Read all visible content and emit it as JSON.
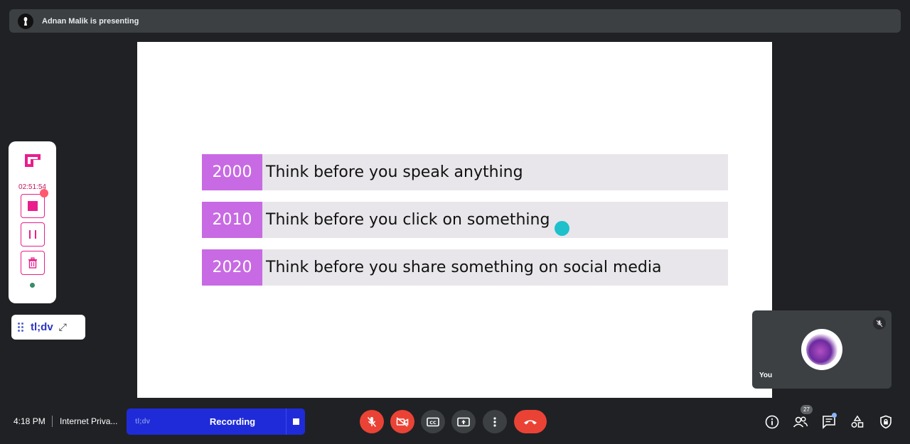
{
  "presenter_bar": {
    "text": "Adnan Malik is presenting"
  },
  "slide": {
    "rows": [
      {
        "year": "2000",
        "text": "Think before you speak anything"
      },
      {
        "year": "2010",
        "text": "Think before you click on something"
      },
      {
        "year": "2020",
        "text": "Think before you share something on social media"
      }
    ]
  },
  "recorder": {
    "timer": "02:51:54",
    "brand": "tl;dv"
  },
  "self_tile": {
    "name": "You"
  },
  "bottom": {
    "time": "4:18 PM",
    "meeting_name": "Internet Priva...",
    "recording_brand": "tl;dv",
    "recording_label": "Recording",
    "people_count": "27"
  },
  "colors": {
    "background": "#202124",
    "year_accent": "#c86ae4",
    "row_bg": "#e8e6ea",
    "danger": "#ea4335",
    "recorder_accent": "#e91e8c",
    "recording_bar": "#1f2bd8"
  }
}
